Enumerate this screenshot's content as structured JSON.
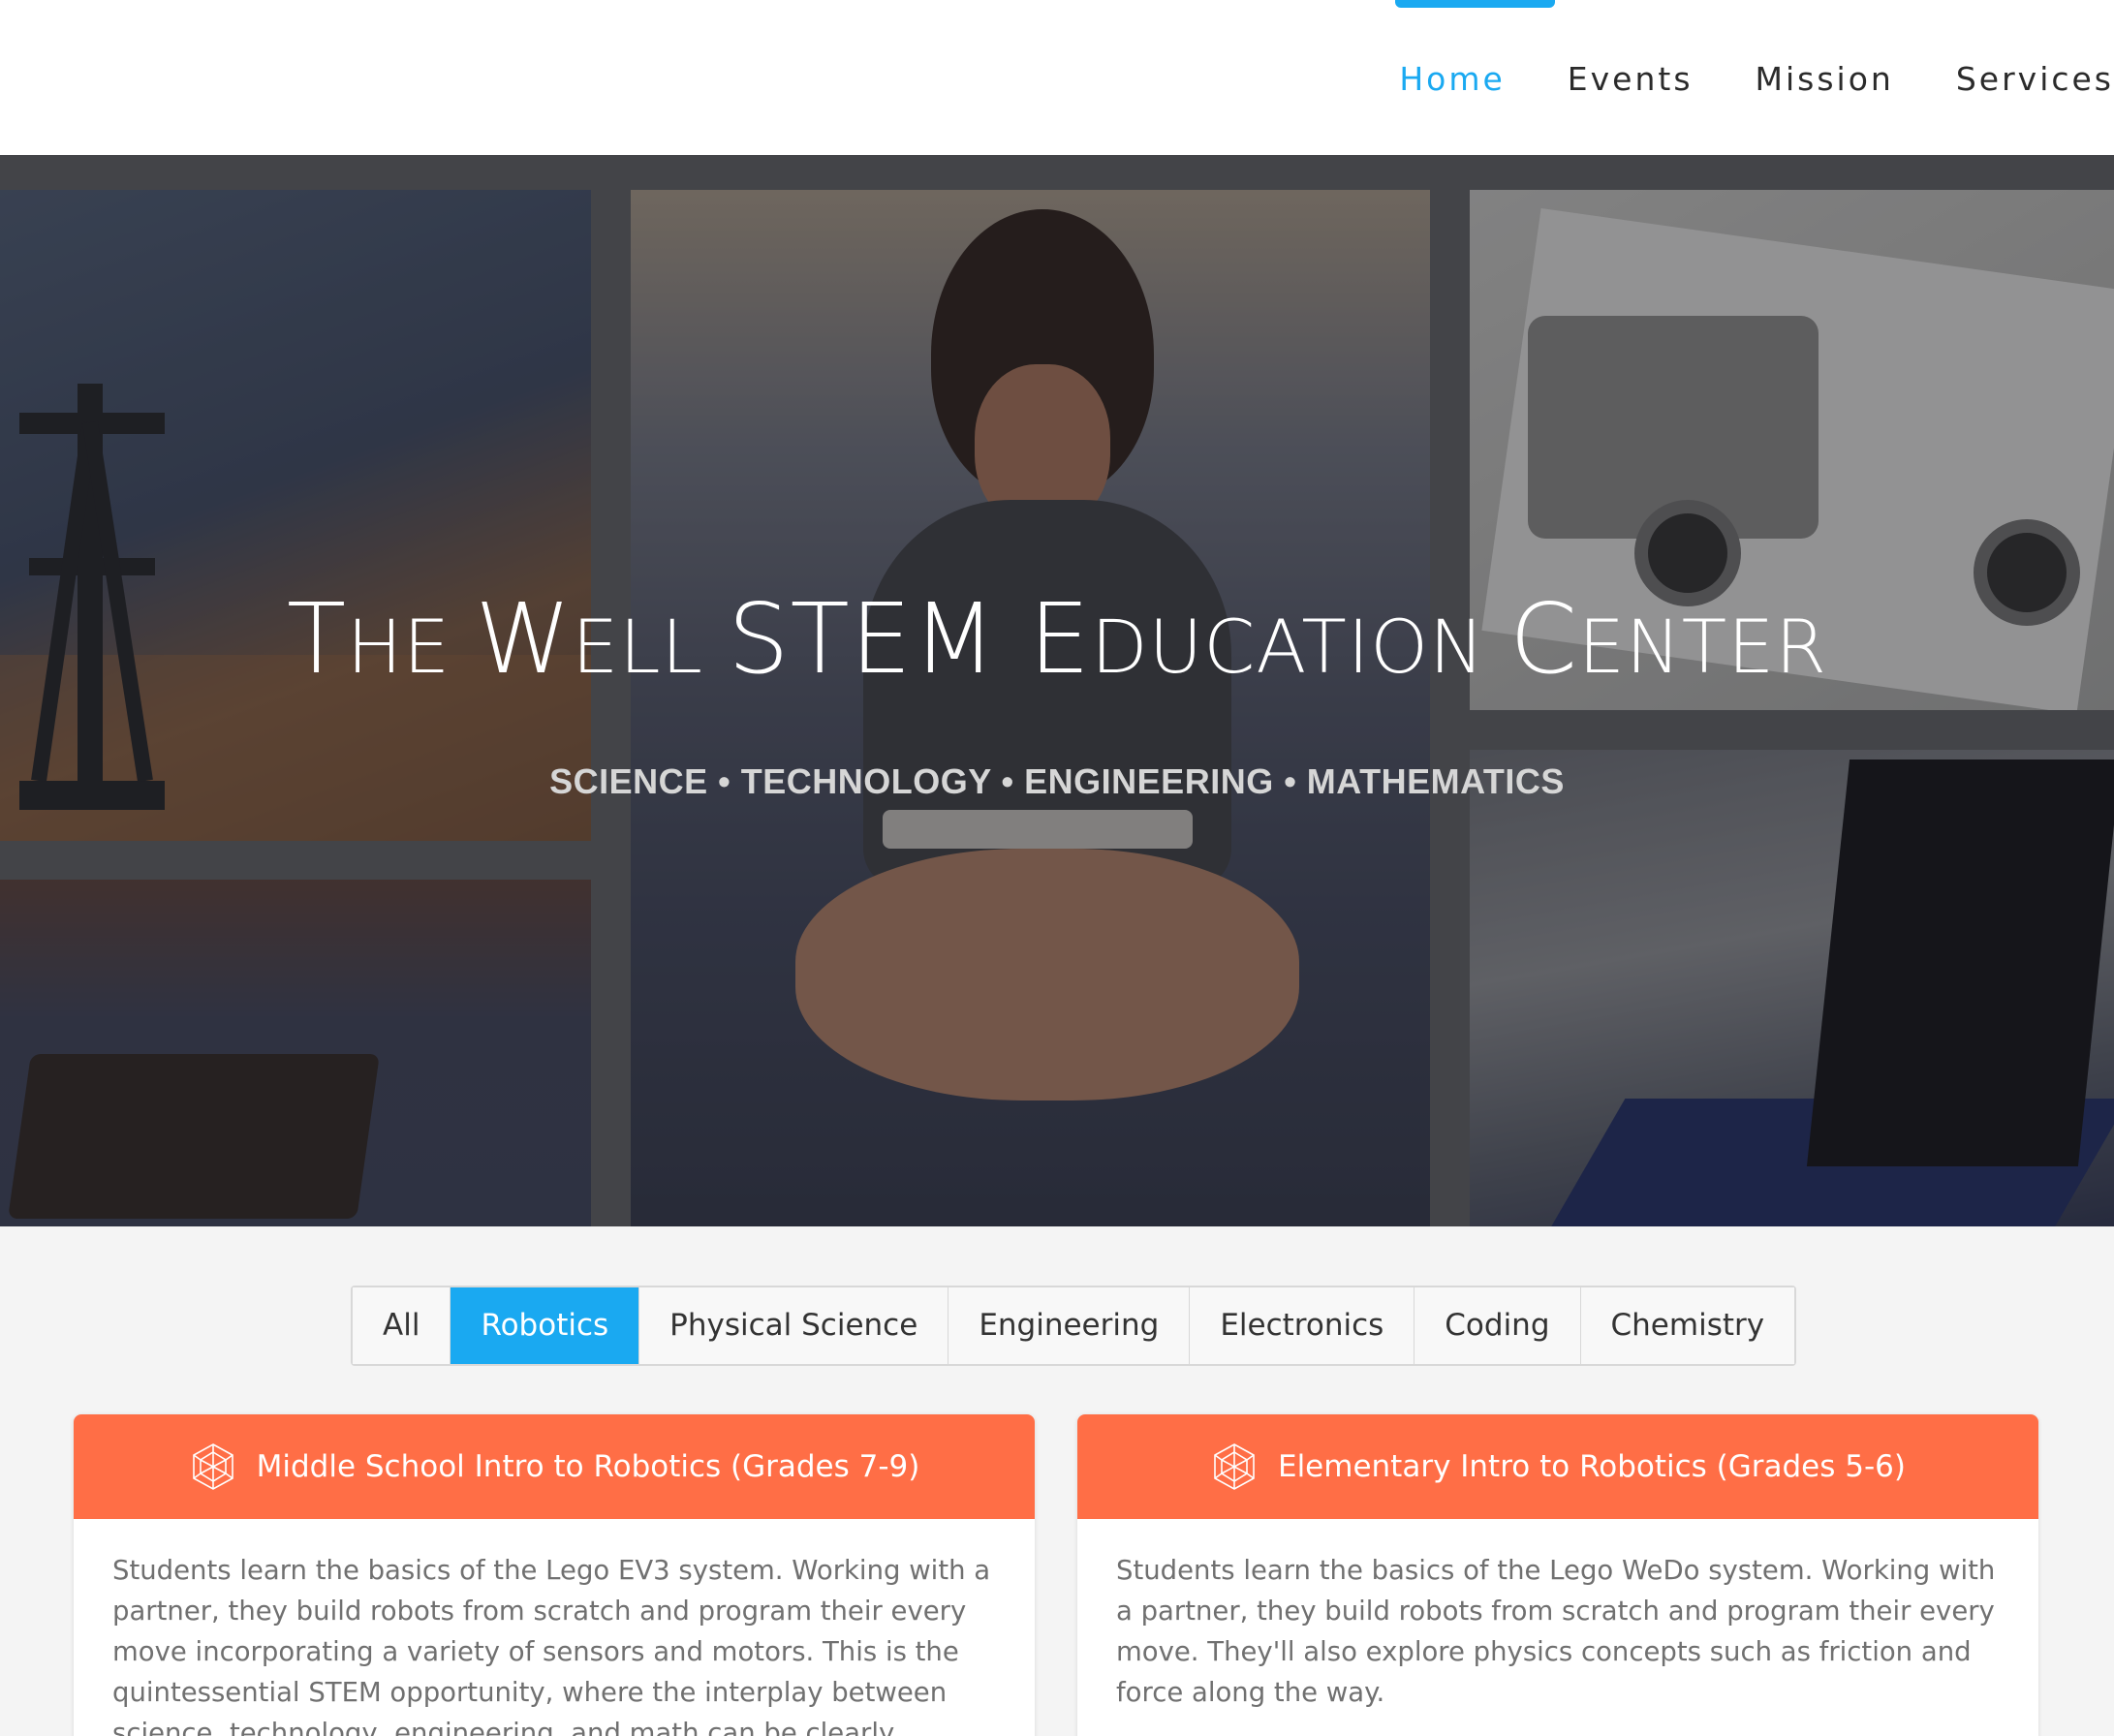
{
  "nav": {
    "items": [
      {
        "label": "Home",
        "active": true
      },
      {
        "label": "Events",
        "active": false
      },
      {
        "label": "Mission",
        "active": false
      },
      {
        "label": "Services",
        "active": false
      }
    ],
    "accent_color": "#1aa9f1"
  },
  "hero": {
    "title_parts": [
      "T",
      "HE ",
      "W",
      "ELL ",
      "STEM E",
      "DUCATION ",
      "C",
      "ENTER"
    ],
    "subtitle": "SCIENCE • TECHNOLOGY • ENGINEERING • MATHEMATICS"
  },
  "filters": {
    "tabs": [
      {
        "label": "All",
        "active": false
      },
      {
        "label": "Robotics",
        "active": true
      },
      {
        "label": "Physical Science",
        "active": false
      },
      {
        "label": "Engineering",
        "active": false
      },
      {
        "label": "Electronics",
        "active": false
      },
      {
        "label": "Coding",
        "active": false
      },
      {
        "label": "Chemistry",
        "active": false
      }
    ]
  },
  "cards": [
    {
      "icon": "geodesic-sphere-icon",
      "title": "Middle School Intro to Robotics (Grades 7-9)",
      "description": "Students learn the basics of the Lego EV3 system. Working with a partner, they build robots from scratch and program their every move incorporating a variety of sensors and motors. This is the quintessential STEM opportunity, where the interplay between science, technology, engineering, and math can be clearly applied."
    },
    {
      "icon": "geodesic-sphere-icon",
      "title": "Elementary Intro to Robotics (Grades 5-6)",
      "description": "Students learn the basics of the Lego WeDo system. Working with a partner, they build robots from scratch and program their every move. They'll also explore physics concepts such as friction and force along the way."
    }
  ],
  "colors": {
    "card_header": "#ff6e46",
    "active_tab": "#1aa9f1",
    "page_background": "#f4f4f4"
  }
}
